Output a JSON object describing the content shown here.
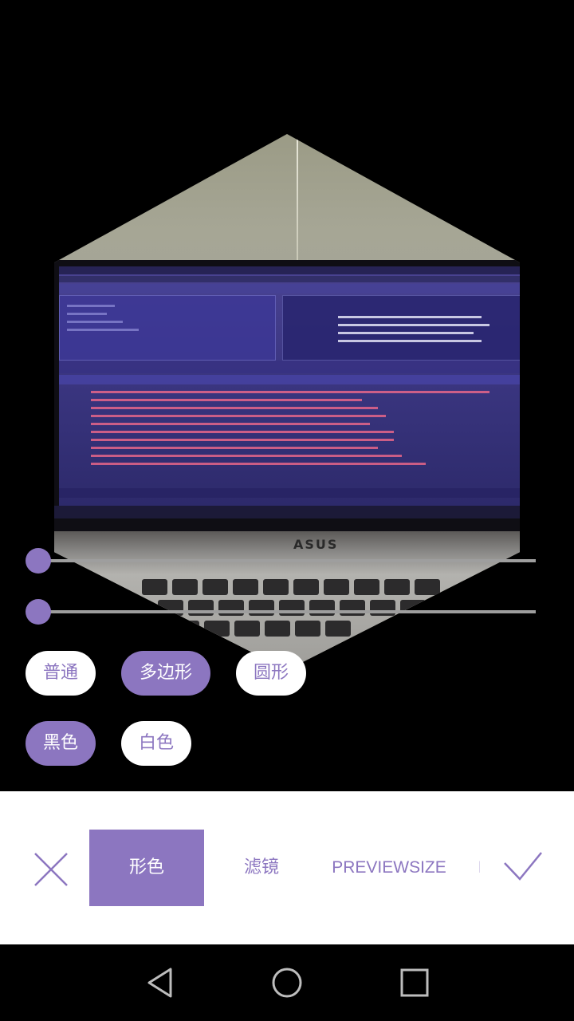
{
  "preview": {
    "screen_brand": "ASUS"
  },
  "sliders": [
    {
      "value": 0
    },
    {
      "value": 0
    }
  ],
  "shape_options": {
    "items": [
      "普通",
      "多边形",
      "圆形"
    ],
    "selected": "多边形"
  },
  "color_options": {
    "items": [
      "黑色",
      "白色"
    ],
    "selected": "黑色"
  },
  "bottom_tabs": {
    "items": [
      "形色",
      "滤镜",
      "PREVIEWSIZE",
      "F"
    ],
    "active": "形色"
  },
  "icons": {
    "close": "close-icon",
    "confirm": "check-icon",
    "back": "nav-back-icon",
    "home": "nav-home-icon",
    "recents": "nav-recents-icon"
  },
  "colors": {
    "accent": "#8c76c0",
    "track": "#9e9e9e",
    "panel": "#ffffff",
    "background": "#000000"
  }
}
